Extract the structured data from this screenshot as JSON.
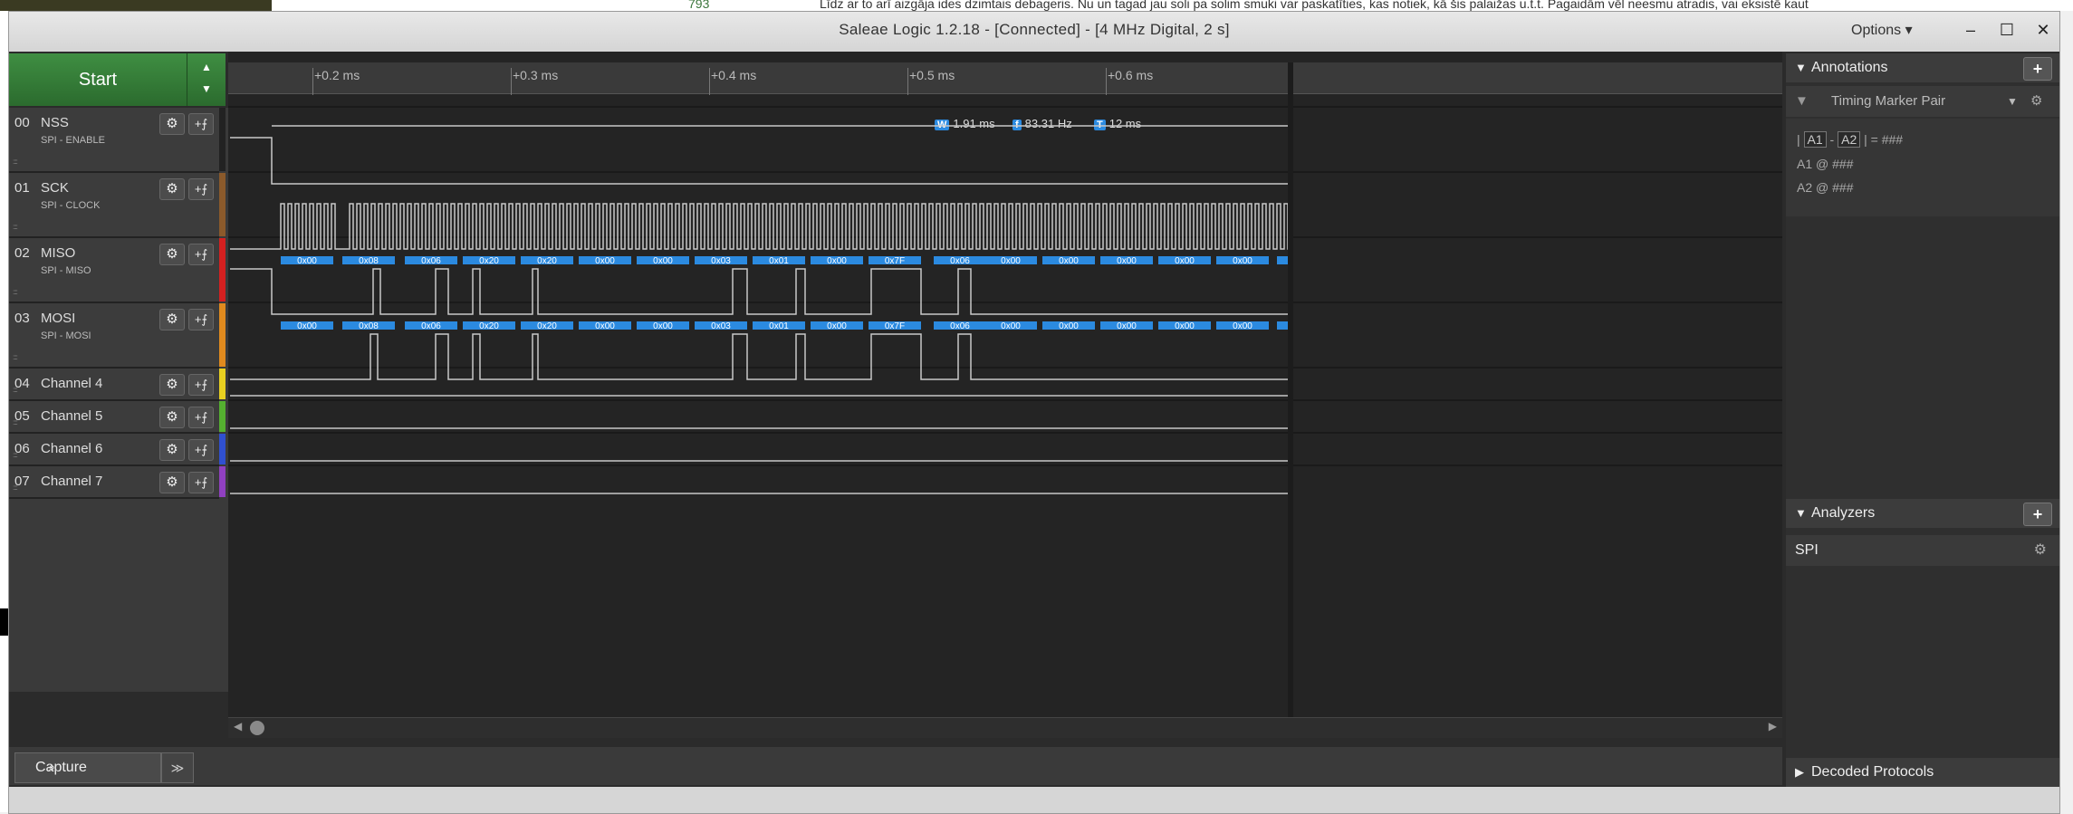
{
  "background": {
    "text": "Līdz ar to arī aizgāja ides dzimtais debageris. Nu un tagad jau soli pa solim smuki var paskatīties, kas notiek, kā šis palaižas u.t.t. Pagaidām vēl neesmu atradis, vai eksistē kaut",
    "count": "793"
  },
  "window": {
    "title": "Saleae Logic 1.2.18 - [Connected] - [4 MHz Digital, 2 s]",
    "options_label": "Options ▾",
    "minimize": "–",
    "maximize": "☐",
    "close": "✕"
  },
  "start_button": "Start",
  "channels": [
    {
      "index": "00",
      "name": "NSS",
      "sub": "SPI - ENABLE",
      "color": "#222222"
    },
    {
      "index": "01",
      "name": "SCK",
      "sub": "SPI - CLOCK",
      "color": "#8b5a2b"
    },
    {
      "index": "02",
      "name": "MISO",
      "sub": "SPI - MISO",
      "color": "#d42020"
    },
    {
      "index": "03",
      "name": "MOSI",
      "sub": "SPI - MOSI",
      "color": "#e08a1e"
    },
    {
      "index": "04",
      "name": "Channel 4",
      "sub": "",
      "color": "#e8d020"
    },
    {
      "index": "05",
      "name": "Channel 5",
      "sub": "",
      "color": "#55b030"
    },
    {
      "index": "06",
      "name": "Channel 6",
      "sub": "",
      "color": "#3050d0"
    },
    {
      "index": "07",
      "name": "Channel 7",
      "sub": "",
      "color": "#9040c0"
    }
  ],
  "ruler_ticks": [
    "+0.2 ms",
    "+0.3 ms",
    "+0.4 ms",
    "+0.5 ms",
    "+0.6 ms"
  ],
  "measurement": {
    "w": "1.91 ms",
    "f": "83.31 Hz",
    "t": "12 ms"
  },
  "marker_letters": {
    "w": "W",
    "f": "f",
    "t": "T"
  },
  "decoded_bytes": [
    "0x00",
    "0x08",
    "0x06",
    "0x20",
    "0x20",
    "0x00",
    "0x00",
    "0x03",
    "0x01",
    "0x00",
    "0x7F",
    "0x06",
    "0x00",
    "0x00",
    "0x00",
    "0x00",
    "0x00"
  ],
  "annotations": {
    "title": "Annotations",
    "plus": "+",
    "timing_marker": "Timing Marker Pair",
    "row1": {
      "a1": "A1",
      "dash": "-",
      "a2": "A2",
      "eq": "| = ###"
    },
    "row2": "A1  @  ###",
    "row3": "A2  @  ###"
  },
  "analyzers": {
    "title": "Analyzers",
    "plus": "+",
    "items": [
      "SPI"
    ]
  },
  "decoded_protocols": "Decoded Protocols",
  "capture_tab": "Capture",
  "icons": {
    "gear": "⚙",
    "trigger": "+⨍",
    "start_up": "▲",
    "start_down": "▼",
    "collapse": "▼",
    "expand": "▶",
    "pin": "▼",
    "more": "≫",
    "search": "⌕"
  },
  "colors": {
    "decoded_bg": "#2b8ae0",
    "start_green": "#348a38"
  }
}
